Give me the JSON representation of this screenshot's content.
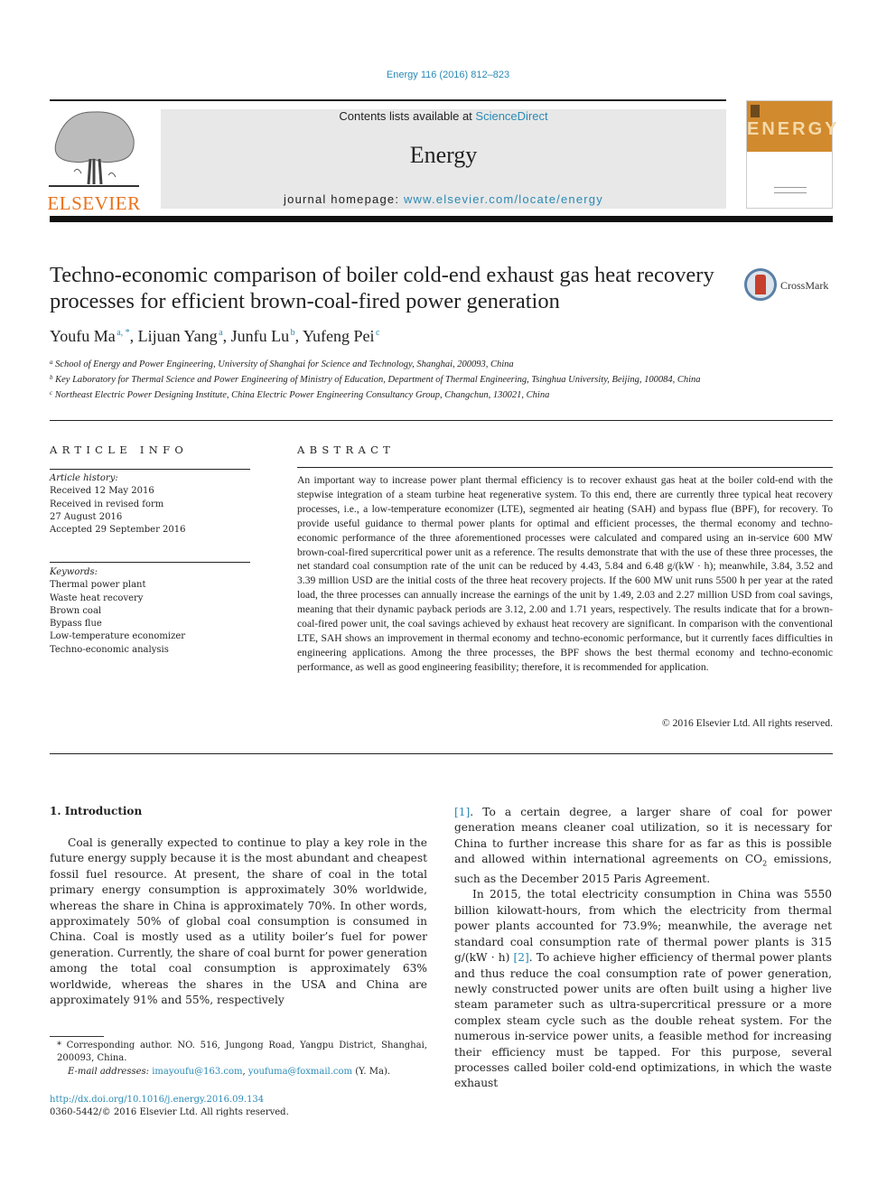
{
  "header": {
    "citation": "Energy 116 (2016) 812–823",
    "contents_prefix": "Contents lists available at ",
    "contents_link": "ScienceDirect",
    "journal_name": "Energy",
    "homepage_prefix": "journal homepage: ",
    "homepage_link": "www.elsevier.com/locate/energy",
    "publisher_logo_text": "ELSEVIER",
    "cover_title": "ENERGY",
    "colors": {
      "link": "#2a8ab5",
      "elsevier_orange": "#e9711c",
      "cover_orange": "#d28a2e",
      "masthead_gray": "#e8e8e8"
    }
  },
  "article": {
    "title": "Techno-economic comparison of boiler cold-end exhaust gas heat recovery processes for efficient brown-coal-fired power generation",
    "crossmark_label": "CrossMark",
    "authors": [
      {
        "name": "Youfu Ma",
        "sup": "a, *",
        "sep": ", "
      },
      {
        "name": "Lijuan Yang",
        "sup": "a",
        "sep": ", "
      },
      {
        "name": "Junfu Lu",
        "sup": "b",
        "sep": ", "
      },
      {
        "name": "Yufeng Pei",
        "sup": "c",
        "sep": ""
      }
    ],
    "affiliations": [
      {
        "key": "a",
        "text": "School of Energy and Power Engineering, University of Shanghai for Science and Technology, Shanghai, 200093, China"
      },
      {
        "key": "b",
        "text": "Key Laboratory for Thermal Science and Power Engineering of Ministry of Education, Department of Thermal Engineering, Tsinghua University, Beijing, 100084, China"
      },
      {
        "key": "c",
        "text": "Northeast Electric Power Designing Institute, China Electric Power Engineering Consultancy Group, Changchun, 130021, China"
      }
    ]
  },
  "article_info": {
    "section_title": "ARTICLE INFO",
    "history_label": "Article history:",
    "history": [
      "Received 12 May 2016",
      "Received in revised form",
      "27 August 2016",
      "Accepted 29 September 2016"
    ],
    "keywords_label": "Keywords:",
    "keywords": [
      "Thermal power plant",
      "Waste heat recovery",
      "Brown coal",
      "Bypass flue",
      "Low-temperature economizer",
      "Techno-economic analysis"
    ]
  },
  "abstract": {
    "section_title": "ABSTRACT",
    "text": "An important way to increase power plant thermal efficiency is to recover exhaust gas heat at the boiler cold-end with the stepwise integration of a steam turbine heat regenerative system. To this end, there are currently three typical heat recovery processes, i.e., a low-temperature economizer (LTE), segmented air heating (SAH) and bypass flue (BPF), for recovery. To provide useful guidance to thermal power plants for optimal and efficient processes, the thermal economy and techno-economic performance of the three aforementioned processes were calculated and compared using an in-service 600 MW brown-coal-fired supercritical power unit as a reference. The results demonstrate that with the use of these three processes, the net standard coal consumption rate of the unit can be reduced by 4.43, 5.84 and 6.48 g/(kW · h); meanwhile, 3.84, 3.52 and 3.39 million USD are the initial costs of the three heat recovery projects. If the 600 MW unit runs 5500 h per year at the rated load, the three processes can annually increase the earnings of the unit by 1.49, 2.03 and 2.27 million USD from coal savings, meaning that their dynamic payback periods are 3.12, 2.00 and 1.71 years, respectively. The results indicate that for a brown-coal-fired power unit, the coal savings achieved by exhaust heat recovery are significant. In comparison with the conventional LTE, SAH shows an improvement in thermal economy and techno-economic performance, but it currently faces difficulties in engineering applications. Among the three processes, the BPF shows the best thermal economy and techno-economic performance, as well as good engineering feasibility; therefore, it is recommended for application.",
    "copyright": "© 2016 Elsevier Ltd. All rights reserved."
  },
  "body": {
    "intro_heading": "1.  Introduction",
    "left_para": "Coal is generally expected to continue to play a key role in the future energy supply because it is the most abundant and cheapest fossil fuel resource. At present, the share of coal in the total primary energy consumption is approximately 30% worldwide, whereas the share in China is approximately 70%. In other words, approximately 50% of global coal consumption is consumed in China. Coal is mostly used as a utility boiler’s fuel for power generation. Currently, the share of coal burnt for power generation among the total coal consumption is approximately 63% worldwide, whereas the shares in the USA and China are approximately 91% and 55%, respectively",
    "right_para1_ref": "[1]",
    "right_para1_a": ". To a certain degree, a larger share of coal for power generation means cleaner coal utilization, so it is necessary for China to further increase this share for as far as this is possible and allowed within international agreements on CO",
    "right_para1_sub": "2",
    "right_para1_b": " emissions, such as the December 2015 Paris Agreement.",
    "right_para2_a": "In 2015, the total electricity consumption in China was 5550 billion kilowatt-hours, from which the electricity from thermal power plants accounted for 73.9%; meanwhile, the average net standard coal consumption rate of thermal power plants is 315 g/(kW · h) ",
    "right_para2_ref": "[2]",
    "right_para2_b": ". To achieve higher efficiency of thermal power plants and thus reduce the coal consumption rate of power generation, newly constructed power units are often built using a higher live steam parameter such as ultra-supercritical pressure or a more complex steam cycle such as the double reheat system. For the numerous in-service power units, a feasible method for increasing their efficiency must be tapped. For this purpose, several processes called boiler cold-end optimizations, in which the waste exhaust"
  },
  "footnote": {
    "corresponding": "* Corresponding author. NO. 516, Jungong Road, Yangpu District, Shanghai, 200093, China.",
    "email_label": "E-mail addresses:",
    "email1": "imayoufu@163.com",
    "email_sep": ", ",
    "email2": "youfuma@foxmail.com",
    "email_owner": " (Y. Ma).",
    "doi": "http://dx.doi.org/10.1016/j.energy.2016.09.134",
    "issn_copyright": "0360-5442/© 2016 Elsevier Ltd. All rights reserved."
  }
}
